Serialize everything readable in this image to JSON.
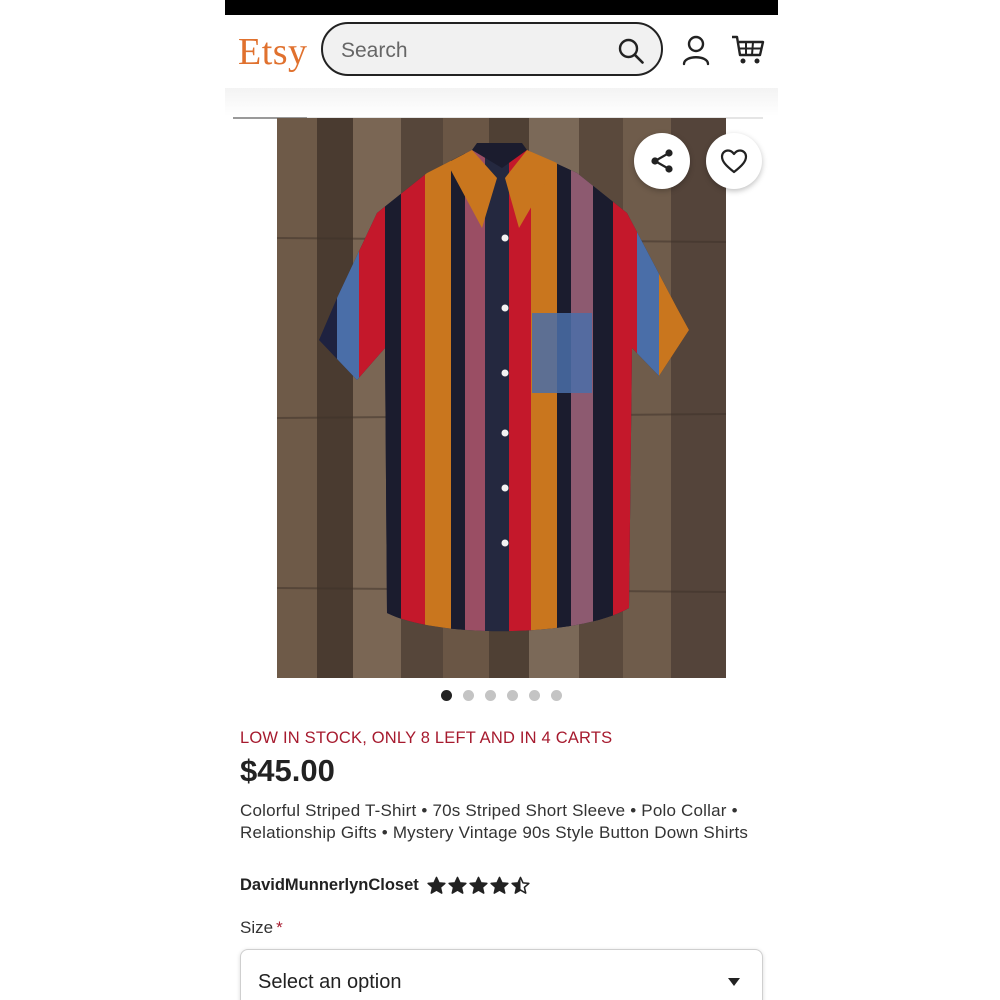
{
  "header": {
    "logo": "Etsy",
    "search_placeholder": "Search"
  },
  "carousel": {
    "image_count": 6,
    "active_index": 0,
    "progress": 0.14
  },
  "listing": {
    "stock_notice": "LOW IN STOCK, ONLY 8 LEFT AND IN 4 CARTS",
    "price": "$45.00",
    "title": "Colorful Striped T-Shirt • 70s Striped Short Sleeve • Polo Collar • Relationship Gifts • Mystery Vintage 90s Style Button Down Shirts",
    "shop_name": "DavidMunnerlynCloset",
    "rating": 4.5,
    "rating_max": 5
  },
  "options": {
    "size_label": "Size",
    "required_mark": "*",
    "size_select_value": "Select an option"
  },
  "colors": {
    "brand": "#e0712e",
    "alert": "#a61a2e",
    "text": "#222222"
  }
}
